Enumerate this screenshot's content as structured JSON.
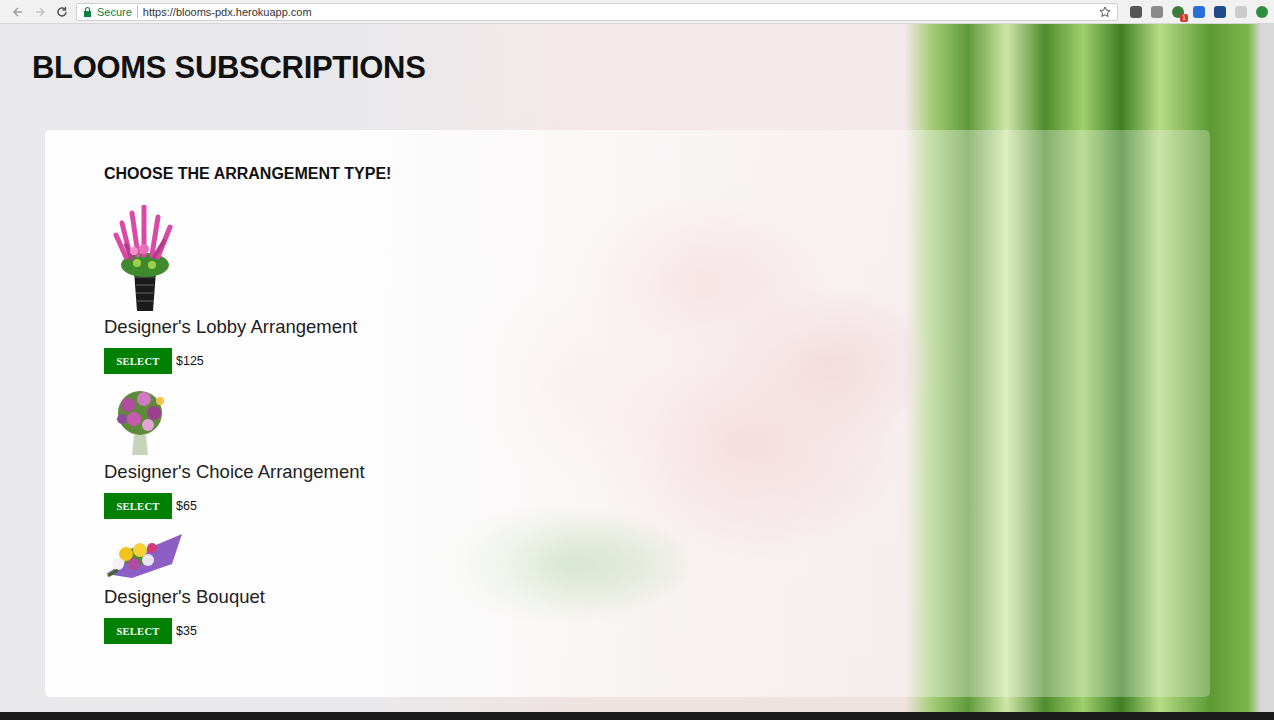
{
  "browser": {
    "secure_label": "Secure",
    "url": "https://blooms-pdx.herokuapp.com",
    "extension_badge": "1"
  },
  "page": {
    "title": "BLOOMS SUBSCRIPTIONS",
    "heading": "CHOOSE THE ARRANGEMENT TYPE!"
  },
  "arrangements": [
    {
      "name": "Designer's Lobby Arrangement",
      "button": "SELECT",
      "price": "$125",
      "kind": "lobby"
    },
    {
      "name": "Designer's Choice Arrangement",
      "button": "SELECT",
      "price": "$65",
      "kind": "choice"
    },
    {
      "name": "Designer's Bouquet",
      "button": "SELECT",
      "price": "$35",
      "kind": "bouquet"
    }
  ]
}
